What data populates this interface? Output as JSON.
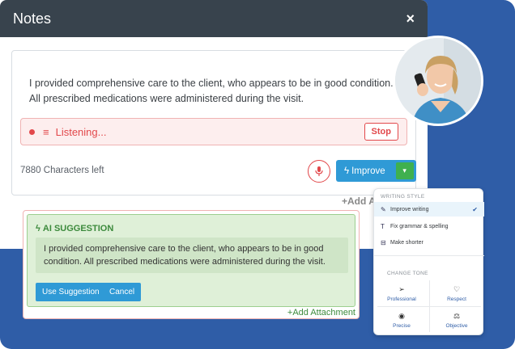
{
  "window": {
    "title": "Notes",
    "close_icon": "×"
  },
  "note": {
    "text": "I provided comprehensive care to the client, who appears to be in good condition. All prescribed medications were administered during the visit."
  },
  "listening": {
    "label": "Listening...",
    "stop_label": "Stop"
  },
  "footer": {
    "chars_left": "7880 Characters left",
    "improve_label": "Improve",
    "add_attachment_partial": "Add A"
  },
  "suggestion": {
    "title": "AI SUGGESTION",
    "text": "I provided comprehensive care to the client, who appears to be in good condition. All prescribed medications were administered during the visit.",
    "use_label": "Use Suggestion",
    "cancel_label": "Cancel",
    "add_attachment": "Add Attachment"
  },
  "style_menu": {
    "writing_style_heading": "WRITING STYLE",
    "items": [
      {
        "label": "Improve writing",
        "icon": "pencil-icon",
        "active": true
      },
      {
        "label": "Fix grammar & spelling",
        "icon": "text-icon",
        "active": false
      },
      {
        "label": "Make shorter",
        "icon": "shorten-icon",
        "active": false
      }
    ],
    "change_tone_heading": "CHANGE TONE",
    "tones": [
      {
        "label": "Professional",
        "icon": "send-icon"
      },
      {
        "label": "Respect",
        "icon": "heart-icon"
      },
      {
        "label": "Precise",
        "icon": "target-icon"
      },
      {
        "label": "Objective",
        "icon": "scale-icon"
      }
    ]
  },
  "colors": {
    "accent_blue": "#2f9ad6",
    "alert_red": "#e2484b",
    "success_green": "#3c8a3c",
    "background": "#2f5da7"
  }
}
